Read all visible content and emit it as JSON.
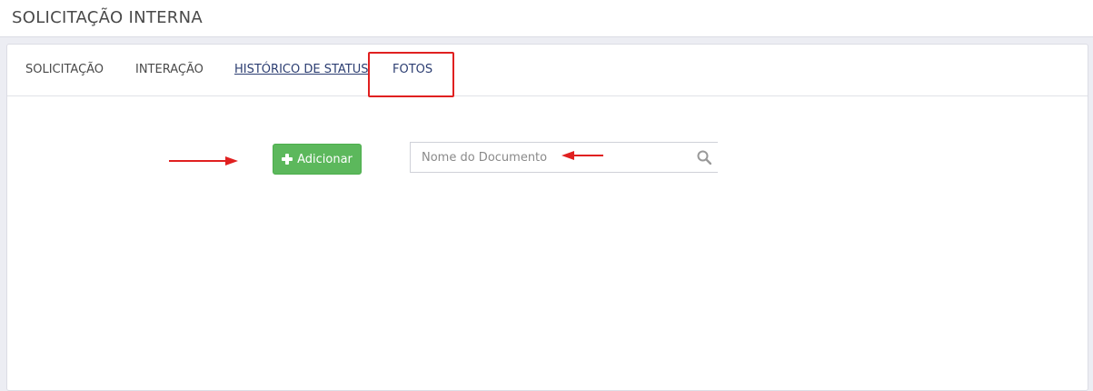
{
  "header": {
    "title": "SOLICITAÇÃO INTERNA"
  },
  "tabs": [
    {
      "label": "SOLICITAÇÃO"
    },
    {
      "label": "INTERAÇÃO"
    },
    {
      "label": "HISTÓRICO DE STATUS"
    },
    {
      "label": "FOTOS"
    }
  ],
  "toolbar": {
    "add_label": "Adicionar",
    "search_placeholder": "Nome do Documento"
  },
  "icons": {
    "add": "plus-icon",
    "search": "search-icon"
  },
  "colors": {
    "add_button": "#5cb85c",
    "annotation": "#e02020",
    "link": "#2c3e72"
  }
}
